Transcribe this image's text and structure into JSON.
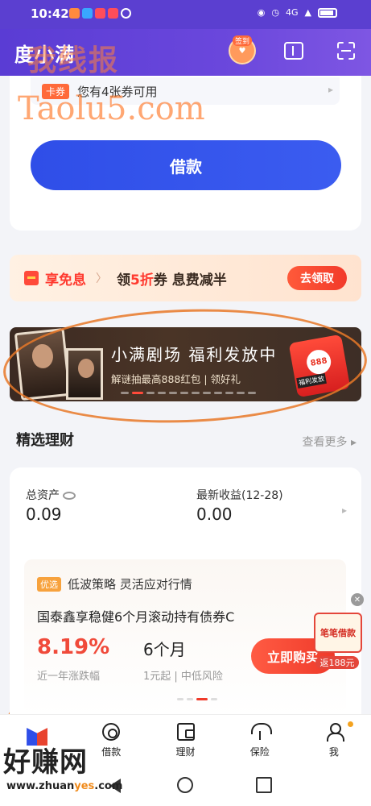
{
  "status_bar": {
    "time": "10:42",
    "signal_label": "4G"
  },
  "header": {
    "app_title": "度小满",
    "checkin_label": "签到"
  },
  "watermark": {
    "top_text": "我线报",
    "url_text": "Taolu5.com",
    "bottom_text": "好赚网",
    "bottom_url_prefix": "www.zhuan",
    "bottom_url_hl": "yes",
    "bottom_url_suffix": ".com"
  },
  "loan": {
    "coupon_tag": "卡券",
    "coupon_text": "您有4张券可用",
    "borrow_label": "借款"
  },
  "promo": {
    "free_label": "享免息",
    "text_prefix": "领",
    "text_highlight": "5折",
    "text_suffix": "券 息费减半",
    "button_label": "去领取"
  },
  "banner": {
    "title": "小满剧场 福利发放中",
    "subtitle": "解谜抽最高888红包 | 领好礼",
    "redpacket_amount": "888",
    "redpacket_tag": "福利发放",
    "dot_count": 12,
    "active_dot": 1
  },
  "section": {
    "title": "精选理财",
    "see_more": "查看更多"
  },
  "finance": {
    "total_assets_label": "总资产",
    "total_assets_value": "0.09",
    "latest_income_label": "最新收益(12-28)",
    "latest_income_value": "0.00",
    "product": {
      "tag": "优选",
      "slogan": "低波策略 灵活应对行情",
      "name": "国泰鑫享稳健6个月滚动持有债券C",
      "rate": "8.19%",
      "rate_label": "近一年涨跌幅",
      "term": "6个月",
      "term_label": "1元起 | 中低风险",
      "buy_label": "立即购买"
    }
  },
  "float_ad": {
    "title": "笔笔借款",
    "amount": "返188元"
  },
  "bottom_nav": {
    "items": [
      {
        "label": ""
      },
      {
        "label": "借款"
      },
      {
        "label": "理财"
      },
      {
        "label": "保险"
      },
      {
        "label": "我"
      }
    ]
  }
}
